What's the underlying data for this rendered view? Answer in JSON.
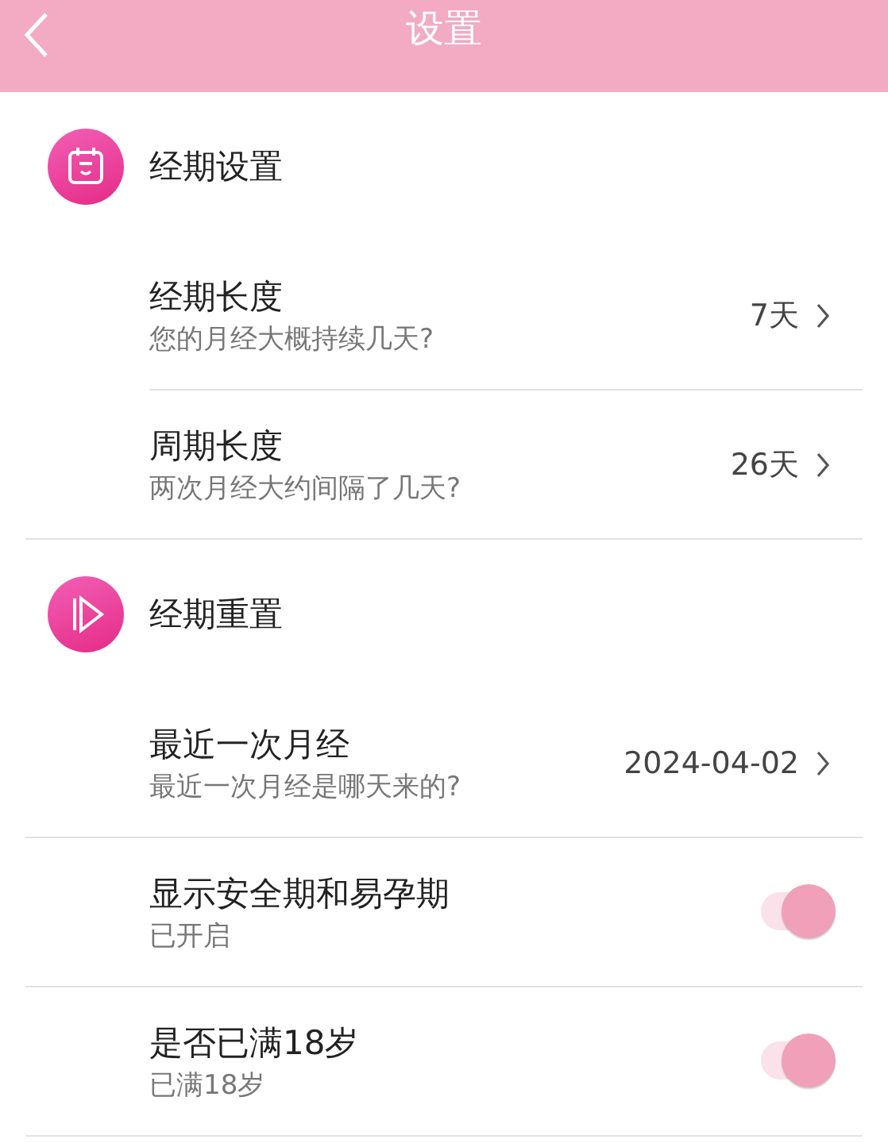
{
  "header": {
    "title": "设置"
  },
  "sections": [
    {
      "title": "经期设置",
      "items": [
        {
          "kind": "value",
          "title": "经期长度",
          "subtitle": "您的月经大概持续几天?",
          "value": "7天"
        },
        {
          "kind": "value",
          "title": "周期长度",
          "subtitle": "两次月经大约间隔了几天?",
          "value": "26天"
        }
      ]
    },
    {
      "title": "经期重置",
      "items": [
        {
          "kind": "value",
          "title": "最近一次月经",
          "subtitle": "最近一次月经是哪天来的?",
          "value": "2024-04-02"
        },
        {
          "kind": "toggle",
          "title": "显示安全期和易孕期",
          "subtitle": "已开启",
          "on": true
        },
        {
          "kind": "toggle",
          "title": "是否已满18岁",
          "subtitle": "已满18岁",
          "on": true
        }
      ]
    }
  ]
}
